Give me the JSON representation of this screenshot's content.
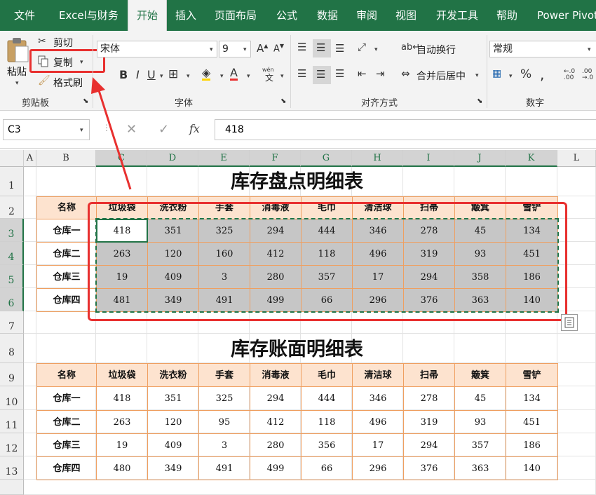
{
  "tabs": [
    "文件",
    "Excel与财务",
    "开始",
    "插入",
    "页面布局",
    "公式",
    "数据",
    "审阅",
    "视图",
    "开发工具",
    "帮助",
    "Power Pivot"
  ],
  "active_tab": "开始",
  "clipboard": {
    "paste": "粘贴",
    "cut": "剪切",
    "copy": "复制",
    "format_painter": "格式刷",
    "group": "剪贴板"
  },
  "font": {
    "name": "宋体",
    "size": "9",
    "group": "字体",
    "pinyin": "wén"
  },
  "alignment": {
    "wrap": "自动换行",
    "merge": "合并后居中",
    "group": "对齐方式"
  },
  "number": {
    "format": "常规",
    "group": "数字"
  },
  "formula_bar": {
    "cell_ref": "C3",
    "fx": "fx",
    "value": "418"
  },
  "colors": {
    "accent": "#217346",
    "header_fill": "#fde3cf",
    "border": "#ef9f60",
    "highlight": "#e8302f"
  },
  "columns": [
    "A",
    "B",
    "C",
    "D",
    "E",
    "F",
    "G",
    "H",
    "I",
    "J",
    "K",
    "L"
  ],
  "rows": [
    "1",
    "2",
    "3",
    "4",
    "5",
    "6",
    "7",
    "8",
    "9",
    "10",
    "11",
    "12",
    "13"
  ],
  "table1": {
    "title": "库存盘点明细表",
    "headers": [
      "名称",
      "垃圾袋",
      "洗衣粉",
      "手套",
      "消毒液",
      "毛巾",
      "清洁球",
      "扫帚",
      "簸箕",
      "雪铲"
    ],
    "rows": [
      [
        "仓库一",
        "418",
        "351",
        "325",
        "294",
        "444",
        "346",
        "278",
        "45",
        "134"
      ],
      [
        "仓库二",
        "263",
        "120",
        "160",
        "412",
        "118",
        "496",
        "319",
        "93",
        "451"
      ],
      [
        "仓库三",
        "19",
        "409",
        "3",
        "280",
        "357",
        "17",
        "294",
        "358",
        "186"
      ],
      [
        "仓库四",
        "481",
        "349",
        "491",
        "499",
        "66",
        "296",
        "376",
        "363",
        "140"
      ]
    ]
  },
  "table2": {
    "title": "库存账面明细表",
    "headers": [
      "名称",
      "垃圾袋",
      "洗衣粉",
      "手套",
      "消毒液",
      "毛巾",
      "清洁球",
      "扫帚",
      "簸箕",
      "雪铲"
    ],
    "rows": [
      [
        "仓库一",
        "418",
        "351",
        "325",
        "294",
        "444",
        "346",
        "278",
        "45",
        "134"
      ],
      [
        "仓库二",
        "263",
        "120",
        "95",
        "412",
        "118",
        "496",
        "319",
        "93",
        "451"
      ],
      [
        "仓库三",
        "19",
        "409",
        "3",
        "280",
        "356",
        "17",
        "294",
        "357",
        "186"
      ],
      [
        "仓库四",
        "480",
        "349",
        "491",
        "499",
        "66",
        "296",
        "376",
        "363",
        "140"
      ]
    ]
  }
}
